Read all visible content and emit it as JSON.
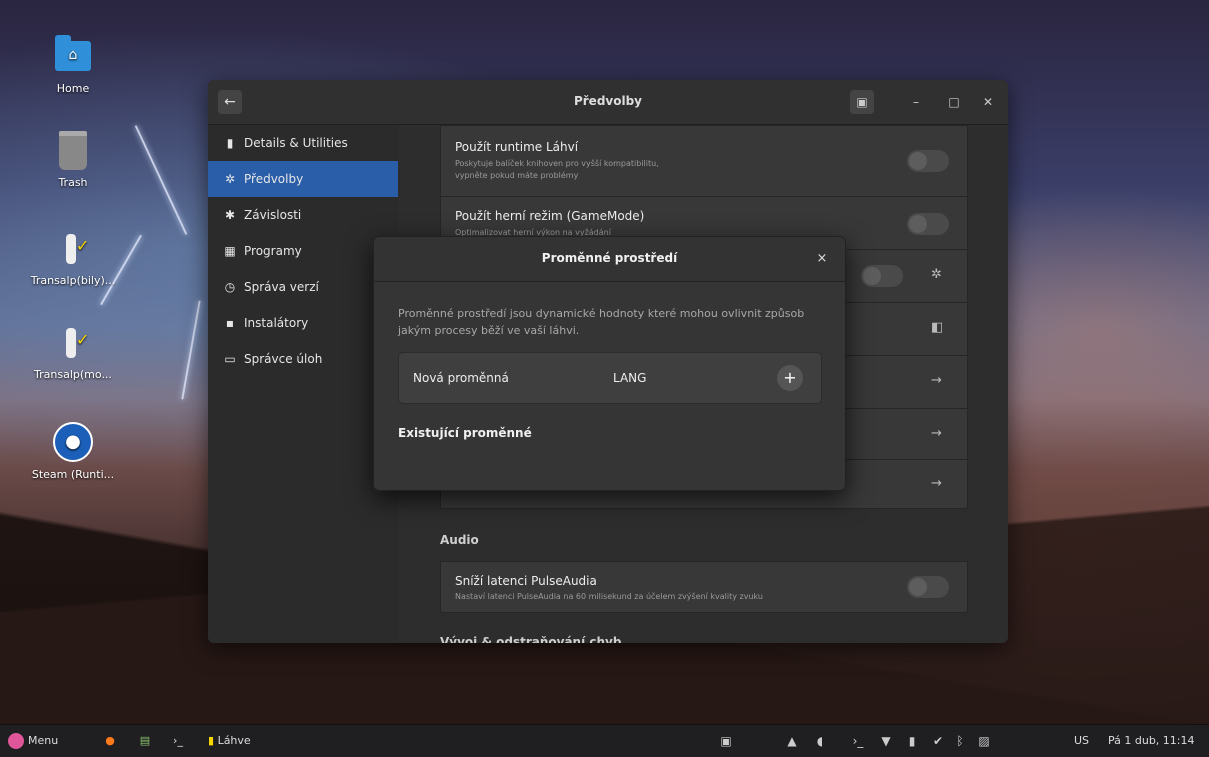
{
  "desktop": {
    "icons": [
      {
        "label": "Home",
        "icon": "folder-home-icon"
      },
      {
        "label": "Trash",
        "icon": "trash-icon"
      },
      {
        "label": "Transalp(bily)...",
        "icon": "bottles-app-icon"
      },
      {
        "label": "Transalp(mo...",
        "icon": "bottles-app-icon"
      },
      {
        "label": "Steam (Runti...",
        "icon": "steam-icon"
      }
    ]
  },
  "window": {
    "title": "Předvolby",
    "back_icon": "back-arrow-icon",
    "sidebar": [
      {
        "label": "Details & Utilities",
        "icon": "bottle-icon",
        "active": false
      },
      {
        "label": "Předvolby",
        "icon": "gear-icon",
        "active": true
      },
      {
        "label": "Závislosti",
        "icon": "puzzle-icon",
        "active": false
      },
      {
        "label": "Programy",
        "icon": "grid-icon",
        "active": false
      },
      {
        "label": "Správa verzí",
        "icon": "history-icon",
        "active": false
      },
      {
        "label": "Instalátory",
        "icon": "installer-icon",
        "active": false
      },
      {
        "label": "Správce úloh",
        "icon": "monitor-icon",
        "active": false
      }
    ],
    "settings": {
      "runtime_title": "Použít runtime Láhví",
      "runtime_sub1": "Poskytuje balíček knihoven pro vyšší kompatibilitu,",
      "runtime_sub2": "vypněte pokud máte problémy",
      "gamemode_title": "Použít herní režim (GameMode)",
      "gamemode_sub": "Optimalizovat herní výkon na vyžádání",
      "audio_section": "Audio",
      "pulse_title": "Sníží latenci PulseAudia",
      "pulse_sub": "Nastaví latenci PulseAudia na 60 milisekund za účelem zvýšení kvality zvuku",
      "dev_section": "Vývoj & odstraňování chyb"
    }
  },
  "dialog": {
    "title": "Proměnné prostředí",
    "description": "Proměnné prostředí jsou dynamické hodnoty které mohou ovlivnit způsob jakým procesy běží ve vaší láhvi.",
    "new_var_label": "Nová proměnná",
    "new_var_value": "LANG",
    "add_symbol": "+",
    "existing_section": "Existující proměnné",
    "close_symbol": "×"
  },
  "taskbar": {
    "menu_label": "Menu",
    "app_label": "Láhve",
    "keyboard_layout": "US",
    "clock": "Pá 1 dub, 11:14"
  }
}
